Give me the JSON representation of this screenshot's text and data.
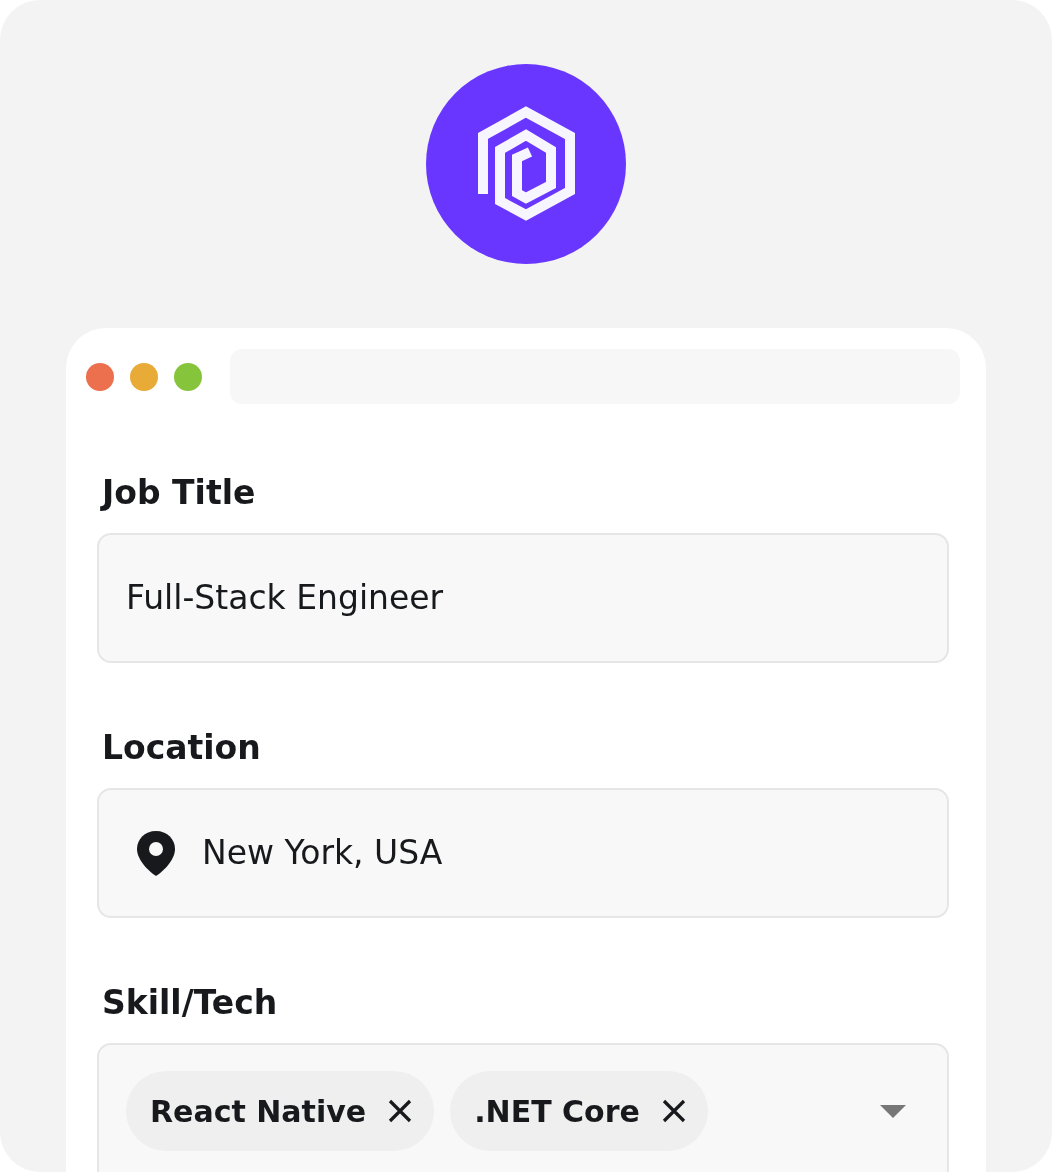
{
  "window": {
    "traffic_lights": [
      {
        "color": "#ec6f4e"
      },
      {
        "color": "#e8ab38"
      },
      {
        "color": "#86c53b"
      }
    ]
  },
  "fields": [
    {
      "label": "Job Title",
      "kind": "text",
      "value": "Full-Stack Engineer"
    },
    {
      "label": "Location",
      "kind": "location",
      "value": "New York, USA"
    },
    {
      "label": "Skill/Tech",
      "kind": "tags",
      "tags": [
        "React Native",
        ".NET Core"
      ]
    }
  ]
}
